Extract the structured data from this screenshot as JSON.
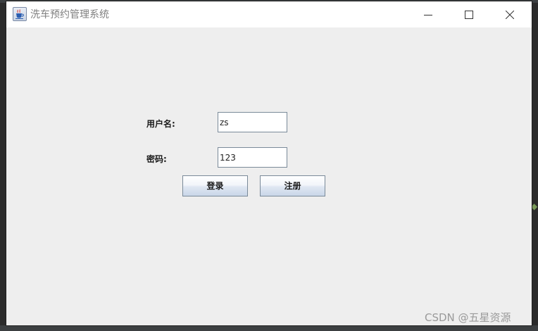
{
  "window": {
    "title": "洗车预约管理系统"
  },
  "form": {
    "username_label": "用户名:",
    "username_value": "zs",
    "password_label": "密码:",
    "password_value": "123"
  },
  "buttons": {
    "login_label": "登录",
    "register_label": "注册"
  },
  "watermark": {
    "text": "CSDN @五星资源"
  },
  "icons": {
    "app": "java-coffee-cup-icon",
    "minimize": "minimize-icon",
    "maximize": "maximize-icon",
    "close": "close-icon"
  },
  "colors": {
    "content_background": "#eeeeee",
    "titlebar_background": "#ffffff",
    "title_text": "#7f7f7f",
    "desktop_background": "#2b2b2b"
  }
}
